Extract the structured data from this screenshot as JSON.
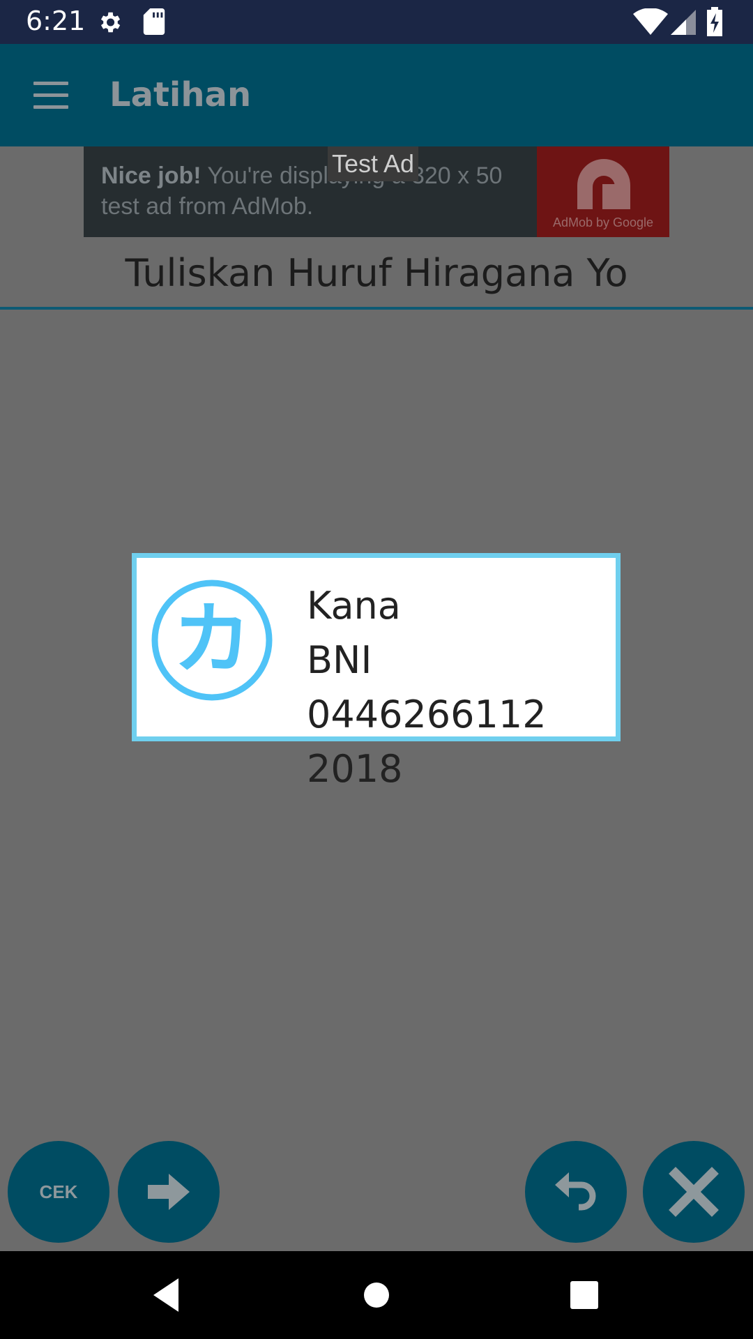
{
  "status_bar": {
    "time": "6:21",
    "icons": [
      "settings-icon",
      "sd-card-icon",
      "wifi-icon",
      "signal-icon",
      "battery-charging-icon"
    ]
  },
  "app_bar": {
    "title": "Latihan",
    "menu_icon": "hamburger-menu-icon"
  },
  "ad": {
    "label": "Test Ad",
    "headline": "Nice job!",
    "body": "You're displaying a 320 x 50 test ad from AdMob.",
    "logo_text": "AdMob by Google"
  },
  "prompt": "Tuliskan Huruf Hiragana Yo",
  "dialog": {
    "logo_glyph": "カ",
    "line1": "Kana",
    "line2": "BNI 0446266112",
    "line3": "2018"
  },
  "buttons": {
    "check_label": "CEK",
    "next_icon": "arrow-right-icon",
    "undo_icon": "undo-icon",
    "clear_icon": "close-icon"
  },
  "nav_bar": {
    "icons": [
      "back-icon",
      "home-icon",
      "recents-icon"
    ]
  },
  "colors": {
    "app_bar": "#004c62",
    "accent": "#4fc3f7",
    "dialog_border": "#6fcfee",
    "overlay": "#6b6b6b"
  }
}
